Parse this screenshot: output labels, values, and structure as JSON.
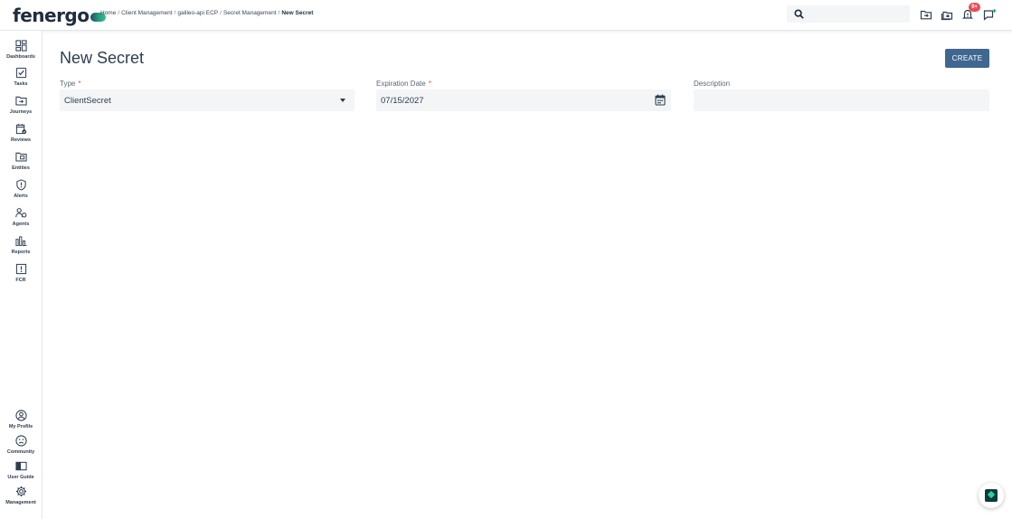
{
  "brand": {
    "name": "fenergo",
    "accent_color": "#3f6790"
  },
  "breadcrumb": [
    "Home",
    "Client Management",
    "galileo-api ECP",
    "Secret Management",
    "New Secret"
  ],
  "breadcrumb_separator": "/",
  "search": {
    "placeholder": "",
    "icon": "search-icon"
  },
  "topbar": {
    "icons": [
      "folder-plus-icon",
      "folders-icon",
      "bell-icon",
      "message-add-icon"
    ],
    "notification_badge": "9+"
  },
  "sidebar": {
    "top_items": [
      {
        "label": "Dashboards",
        "icon": "dashboard-icon"
      },
      {
        "label": "Tasks",
        "icon": "checkbox-icon"
      },
      {
        "label": "Journeys",
        "icon": "folder-arrow-icon"
      },
      {
        "label": "Reviews",
        "icon": "calendar-check-icon"
      },
      {
        "label": "Entities",
        "icon": "entity-folder-icon"
      },
      {
        "label": "Alerts",
        "icon": "shield-alert-icon"
      },
      {
        "label": "Agents",
        "icon": "agents-icon"
      },
      {
        "label": "Reports",
        "icon": "bar-chart-icon"
      },
      {
        "label": "FCR",
        "icon": "alert-box-icon"
      }
    ],
    "bottom_items": [
      {
        "label": "My Profile",
        "icon": "user-circle-icon"
      },
      {
        "label": "Community",
        "icon": "smiley-icon"
      },
      {
        "label": "User Guide",
        "icon": "book-icon"
      },
      {
        "label": "Management",
        "icon": "gear-icon"
      }
    ]
  },
  "main": {
    "title": "New Secret",
    "create_label": "CREATE",
    "fields": {
      "type": {
        "label": "Type",
        "required_mark": "*",
        "value": "ClientSecret"
      },
      "expiration": {
        "label": "Expiration Date",
        "required_mark": "*",
        "value": "07/15/2027"
      },
      "description": {
        "label": "Description",
        "value": ""
      }
    }
  }
}
